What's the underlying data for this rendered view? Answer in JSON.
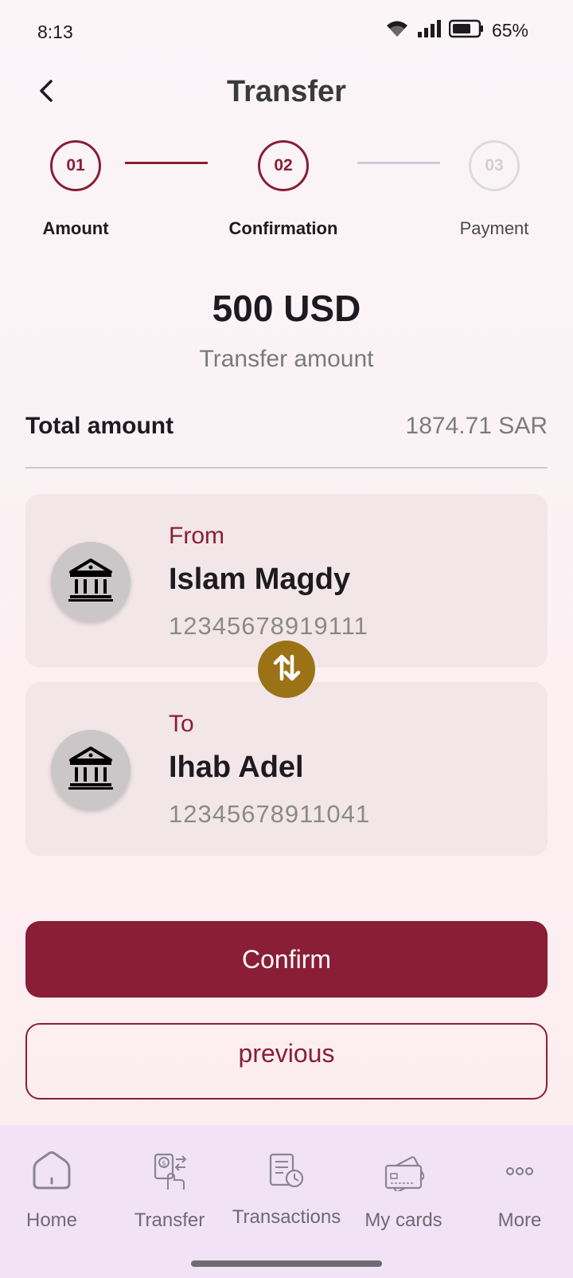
{
  "status_bar": {
    "time": "8:13",
    "battery_text": "65%",
    "icons": [
      "wifi-icon",
      "signal-icon",
      "battery-icon"
    ]
  },
  "header": {
    "title": "Transfer",
    "back_icon": "chevron-left-icon"
  },
  "stepper": {
    "steps": [
      {
        "number": "01",
        "label": "Amount",
        "state": "completed"
      },
      {
        "number": "02",
        "label": "Confirmation",
        "state": "active"
      },
      {
        "number": "03",
        "label": "Payment",
        "state": "upcoming"
      }
    ]
  },
  "amount": {
    "value": "500 USD",
    "caption": "Transfer amount"
  },
  "total": {
    "label": "Total amount",
    "value": "1874.71 SAR"
  },
  "from": {
    "role": "From",
    "name": "Islam Magdy",
    "account": "12345678919111",
    "icon": "bank-icon"
  },
  "to": {
    "role": "To",
    "name": "Ihab Adel",
    "account": "12345678911041",
    "icon": "bank-icon"
  },
  "swap_icon": "swap-vertical-icon",
  "actions": {
    "confirm_label": "Confirm",
    "previous_label": "previous"
  },
  "bottom_nav": {
    "items": [
      {
        "label": "Home",
        "icon": "home-icon"
      },
      {
        "label": "Transfer",
        "icon": "transfer-icon"
      },
      {
        "label": "Transactions",
        "icon": "transactions-icon"
      },
      {
        "label": "My cards",
        "icon": "card-icon"
      },
      {
        "label": "More",
        "icon": "more-icon"
      }
    ]
  },
  "colors": {
    "primary": "#8a1e36",
    "accent_gold": "#9b7316",
    "card_bg": "#f2e6e8",
    "nav_bg": "#f1e2f6"
  }
}
